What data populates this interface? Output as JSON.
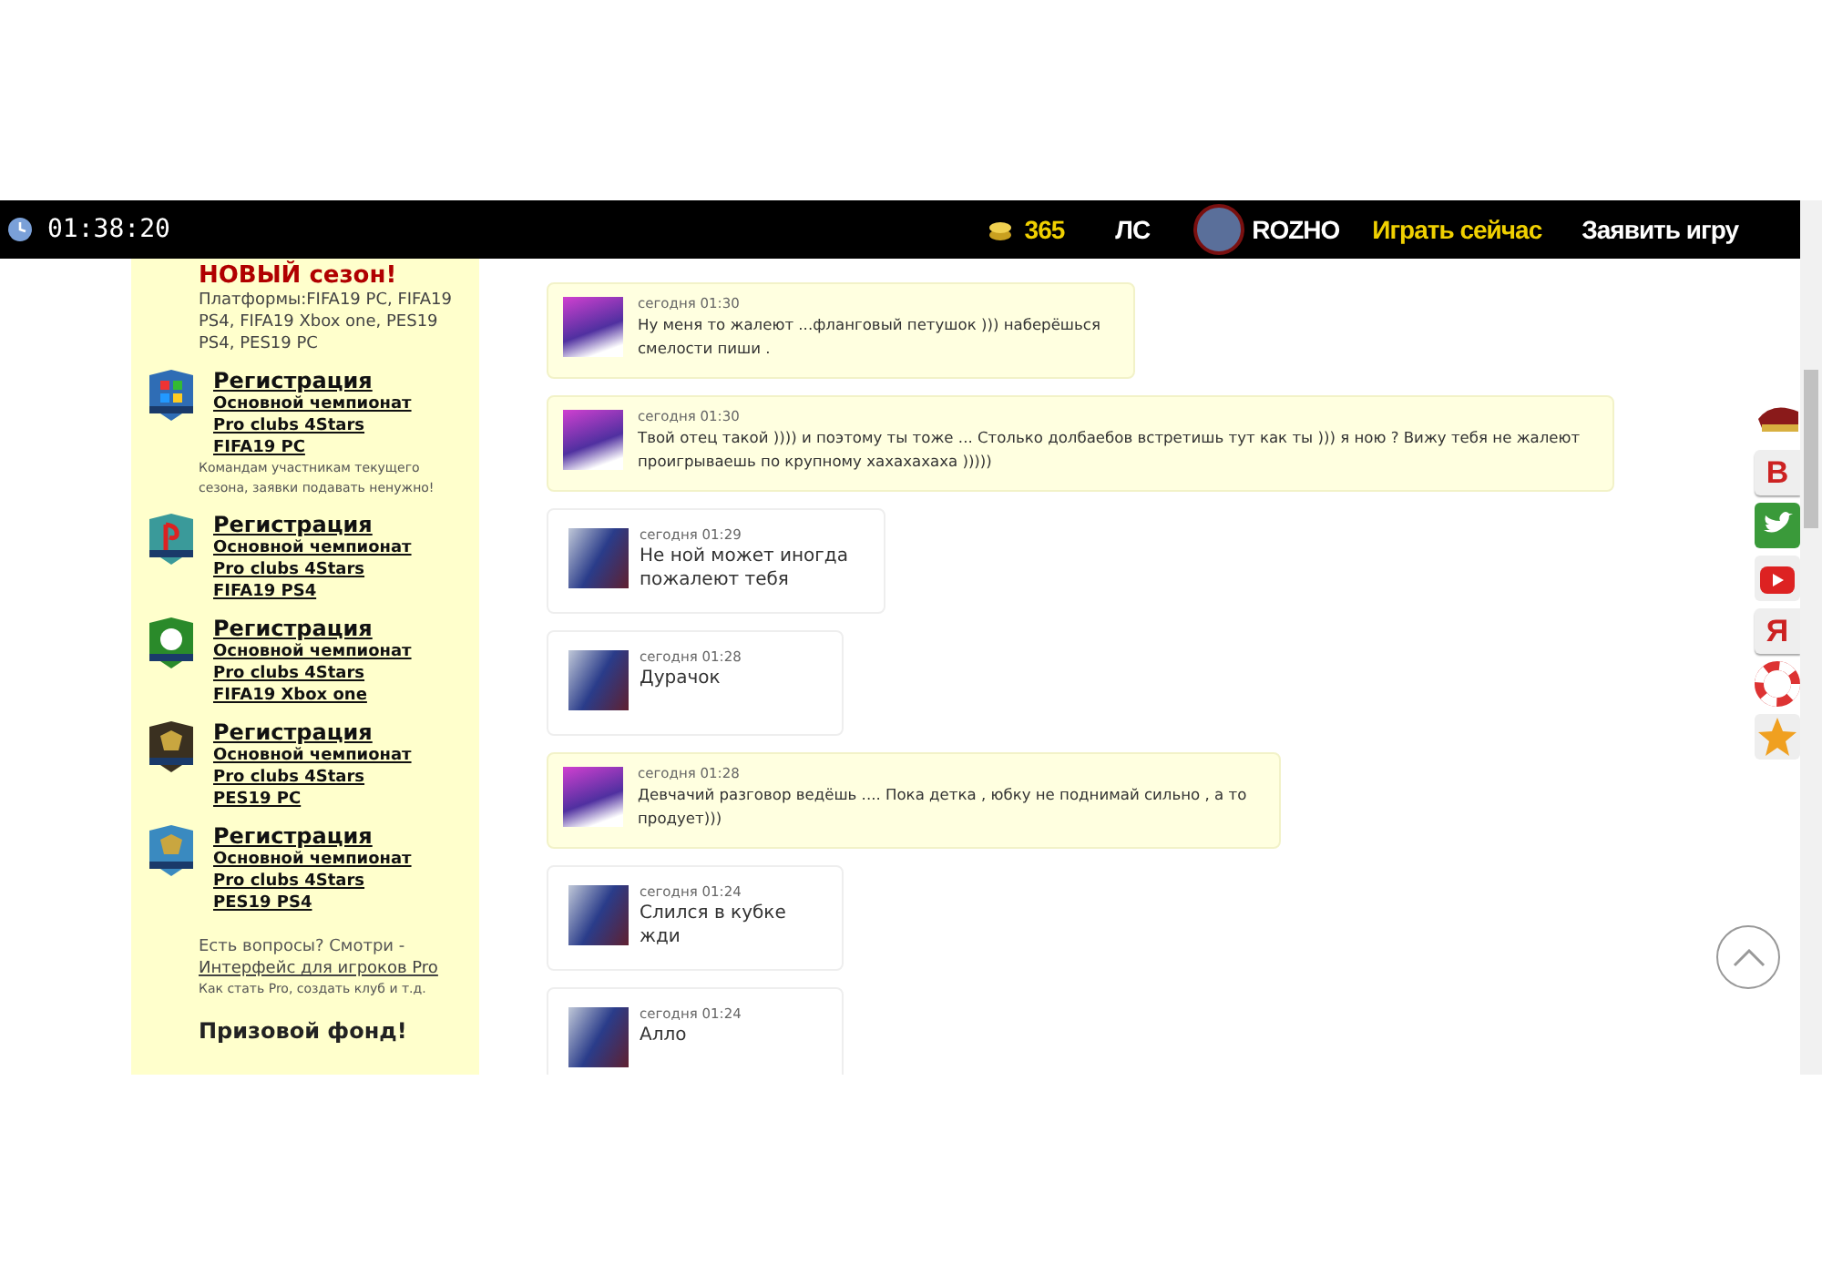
{
  "topbar": {
    "time": "01:38:20",
    "coins": "365",
    "messages_link": "ЛС",
    "username": "ROZHO",
    "play_now": "Играть сейчас",
    "announce_game": "Заявить игру"
  },
  "sidebar": {
    "season_title": "НОВЫЙ сезон!",
    "platforms": "Платформы:FIFA19 PC, FIFA19 PS4, FIFA19 Xbox one, PES19 PS4, PES19 PC",
    "registrations": [
      {
        "kind": "windows",
        "title": "Регистрация",
        "lines": [
          "Основной чемпионат",
          "Pro clubs 4Stars",
          "FIFA19 PC"
        ],
        "note": "Командам участникам текущего сезона, заявки подавать ненужно!"
      },
      {
        "kind": "playstation",
        "title": "Регистрация",
        "lines": [
          "Основной чемпионат",
          "Pro clubs 4Stars",
          "FIFA19 PS4"
        ]
      },
      {
        "kind": "xbox",
        "title": "Регистрация",
        "lines": [
          "Основной чемпионат",
          "Pro clubs 4Stars",
          "FIFA19 Xbox one"
        ]
      },
      {
        "kind": "pes-dark",
        "title": "Регистрация",
        "lines": [
          "Основной чемпионат",
          "Pro clubs 4Stars",
          "PES19 PC"
        ]
      },
      {
        "kind": "pes-blue",
        "title": "Регистрация",
        "lines": [
          "Основной чемпионат",
          "Pro clubs 4Stars",
          "PES19 PS4"
        ]
      }
    ],
    "questions": "Есть вопросы? Смотри -",
    "questions_link": "Интерфейс для игроков Pro",
    "questions_hint": "Как стать Pro, создать клуб и т.д.",
    "prize_title": "Призовой фонд!"
  },
  "messages": [
    {
      "kind": "outgoing",
      "time": "сегодня 01:30",
      "text": "Ну меня то жалеют ...фланговый петушок ))) наберёшься\nсмелости пиши ."
    },
    {
      "kind": "outgoing",
      "time": "сегодня 01:30",
      "text": "Твой отец такой )))) и поэтому ты тоже ... Столько долбаебов встретишь тут как ты ))) я ною ? Вижу тебя не жалеют\nпроигрываешь по крупному хахахахаха )))))"
    },
    {
      "kind": "incoming",
      "time": "сегодня 01:29",
      "text": "Не ной может иногда\nпожалеют тебя"
    },
    {
      "kind": "incoming",
      "time": "сегодня 01:28",
      "text": "Дурачок"
    },
    {
      "kind": "outgoing",
      "time": "сегодня 01:28",
      "text": "Девчачий разговор ведёшь .... Пока детка , юбку не поднимай сильно , а то\nпродует)))"
    },
    {
      "kind": "incoming",
      "time": "сегодня 01:24",
      "text": "Слился в кубке\nжди"
    },
    {
      "kind": "incoming",
      "time": "сегодня 01:24",
      "text": "Алло"
    }
  ],
  "social": [
    {
      "kind": "cap"
    },
    {
      "kind": "letter",
      "glyph": "В"
    },
    {
      "kind": "bird"
    },
    {
      "kind": "video"
    },
    {
      "kind": "letter",
      "glyph": "Я"
    },
    {
      "kind": "lifebuoy"
    },
    {
      "kind": "star"
    }
  ]
}
